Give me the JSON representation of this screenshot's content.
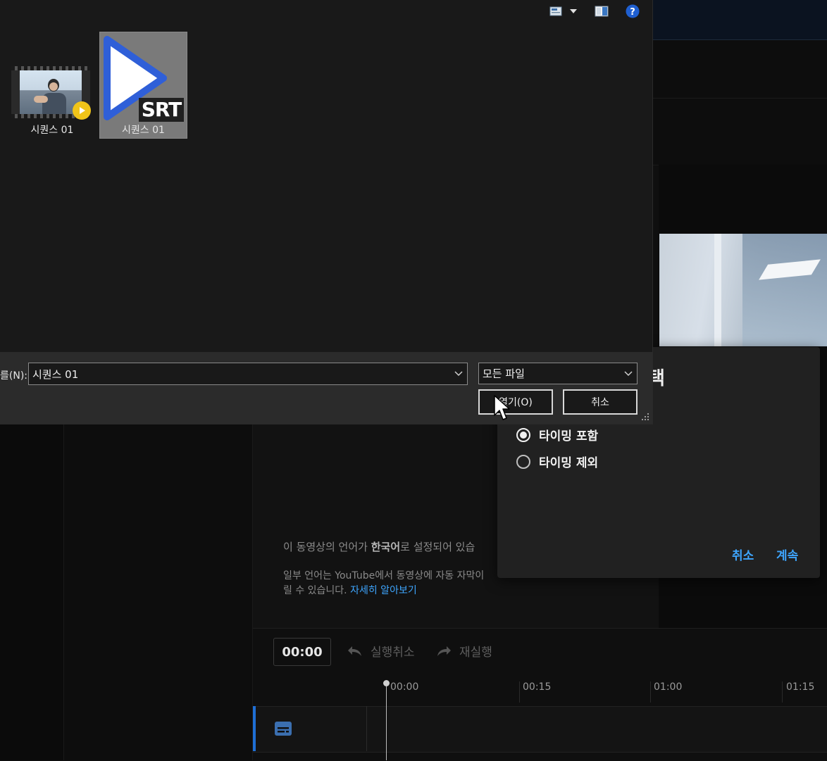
{
  "file_dialog": {
    "files": [
      {
        "name": "시퀀스 01",
        "type": "video",
        "icon": "video-file-icon"
      },
      {
        "name": "시퀀스 01",
        "type": "srt",
        "icon": "srt-file-icon",
        "badge": "SRT",
        "selected": true
      }
    ],
    "filename_label": "를(N):",
    "filename_value": "시퀀스 01",
    "filter_value": "모든 파일",
    "open_button": "열기(O)",
    "cancel_button": "취소",
    "toolbar_icons": [
      "view-mode-icon",
      "chevron-down-icon",
      "preview-pane-icon",
      "help-icon"
    ]
  },
  "yt_dialog": {
    "title_fragment": "택",
    "options": [
      {
        "label": "타이밍 포함",
        "checked": true
      },
      {
        "label": "타이밍 제외",
        "checked": false
      }
    ],
    "cancel": "취소",
    "continue": "계속"
  },
  "background": {
    "language_note_pre": "이 동영상의 언어가 ",
    "language_note_bold": "한국어",
    "language_note_post": "로 설정되어 있습",
    "auto_caption_line1": "일부 언어는 YouTube에서 동영상에 자동 자막이",
    "auto_caption_line2": "릴 수 있습니다.",
    "learn_more": "자세히 알아보기",
    "timecode": "00:00",
    "undo": "실행취소",
    "redo": "재실행",
    "ticks": [
      "00:00",
      "00:15",
      "01:00",
      "01:15"
    ]
  },
  "colors": {
    "accent_blue": "#3ea6ff",
    "track_accent": "#1f6fd6",
    "badge_yellow": "#f0c419"
  }
}
